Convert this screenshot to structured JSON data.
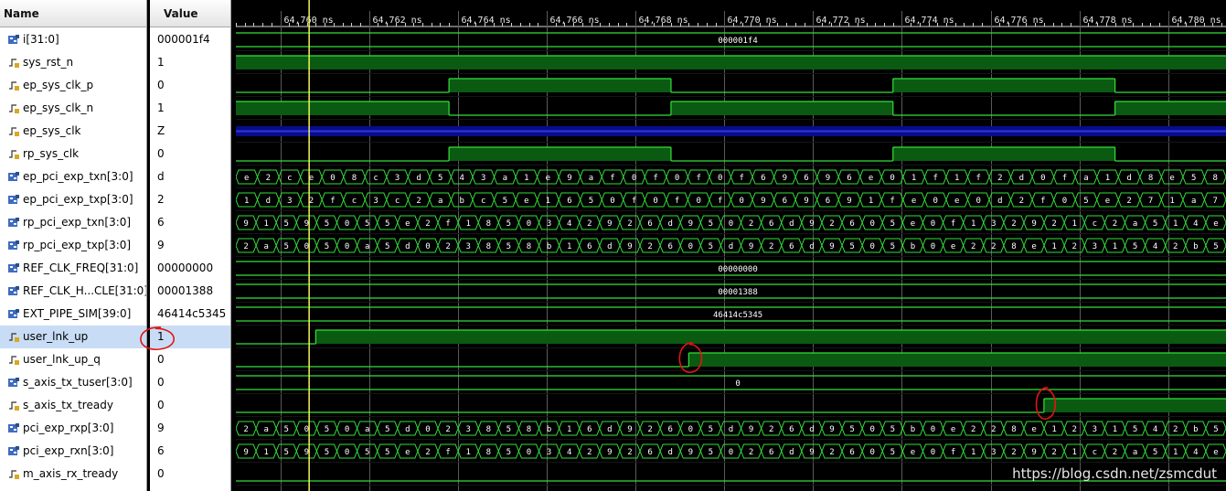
{
  "columns": {
    "name": "Name",
    "value": "Value"
  },
  "selected_row": 13,
  "signals": [
    {
      "name": "i[31:0]",
      "value": "000001f4",
      "icon": "bus-signal-icon",
      "kind": "const",
      "label": "000001f4"
    },
    {
      "name": "sys_rst_n",
      "value": "1",
      "icon": "logic-signal-icon",
      "kind": "high"
    },
    {
      "name": "ep_sys_clk_p",
      "value": "0",
      "icon": "logic-signal-icon",
      "kind": "clk_p"
    },
    {
      "name": "ep_sys_clk_n",
      "value": "1",
      "icon": "logic-signal-icon",
      "kind": "clk_n"
    },
    {
      "name": "ep_sys_clk",
      "value": "Z",
      "icon": "logic-signal-icon",
      "kind": "highz"
    },
    {
      "name": "rp_sys_clk",
      "value": "0",
      "icon": "logic-signal-icon",
      "kind": "clk_p"
    },
    {
      "name": "ep_pci_exp_txn[3:0]",
      "value": "d",
      "icon": "bus-signal-icon",
      "kind": "bus",
      "segments": [
        "e",
        "2",
        "c",
        "e",
        "0",
        "8",
        "c",
        "3",
        "d",
        "5",
        "4",
        "3",
        "a",
        "1",
        "e",
        "9",
        "a",
        "f",
        "0",
        "f",
        "0",
        "f",
        "0",
        "f",
        "6",
        "9",
        "6",
        "9",
        "6",
        "e",
        "0",
        "1",
        "f",
        "1",
        "f",
        "2",
        "d",
        "0",
        "f",
        "a",
        "1",
        "d",
        "8",
        "e",
        "5",
        "8"
      ]
    },
    {
      "name": "ep_pci_exp_txp[3:0]",
      "value": "2",
      "icon": "bus-signal-icon",
      "kind": "bus",
      "segments": [
        "1",
        "d",
        "3",
        "2",
        "f",
        "c",
        "3",
        "c",
        "2",
        "a",
        "b",
        "c",
        "5",
        "e",
        "1",
        "6",
        "5",
        "0",
        "f",
        "0",
        "f",
        "0",
        "f",
        "0",
        "9",
        "6",
        "9",
        "6",
        "9",
        "1",
        "f",
        "e",
        "0",
        "e",
        "0",
        "d",
        "2",
        "f",
        "0",
        "5",
        "e",
        "2",
        "7",
        "1",
        "a",
        "7"
      ]
    },
    {
      "name": "rp_pci_exp_txn[3:0]",
      "value": "6",
      "icon": "bus-signal-icon",
      "kind": "bus",
      "segments": [
        "9",
        "1",
        "5",
        "9",
        "5",
        "0",
        "5",
        "5",
        "e",
        "2",
        "f",
        "1",
        "8",
        "5",
        "0",
        "3",
        "4",
        "2",
        "9",
        "2",
        "6",
        "d",
        "9",
        "5",
        "0",
        "2",
        "6",
        "d",
        "9",
        "2",
        "6",
        "0",
        "5",
        "e",
        "0",
        "f",
        "1",
        "3",
        "2",
        "9",
        "2",
        "1",
        "c",
        "2",
        "a",
        "5",
        "1",
        "4",
        "e"
      ]
    },
    {
      "name": "rp_pci_exp_txp[3:0]",
      "value": "9",
      "icon": "bus-signal-icon",
      "kind": "bus",
      "segments": [
        "2",
        "a",
        "5",
        "0",
        "5",
        "0",
        "a",
        "5",
        "d",
        "0",
        "2",
        "3",
        "8",
        "5",
        "8",
        "b",
        "1",
        "6",
        "d",
        "9",
        "2",
        "6",
        "0",
        "5",
        "d",
        "9",
        "2",
        "6",
        "d",
        "9",
        "5",
        "0",
        "5",
        "b",
        "0",
        "e",
        "2",
        "2",
        "8",
        "e",
        "1",
        "2",
        "3",
        "1",
        "5",
        "4",
        "2",
        "b",
        "5"
      ]
    },
    {
      "name": "REF_CLK_FREQ[31:0]",
      "value": "00000000",
      "icon": "bus-signal-icon",
      "kind": "const",
      "label": "00000000"
    },
    {
      "name": "REF_CLK_H...CLE[31:0]",
      "value": "00001388",
      "icon": "bus-signal-icon",
      "kind": "const",
      "label": "00001388"
    },
    {
      "name": "EXT_PIPE_SIM[39:0]",
      "value": "46414c5345",
      "icon": "bus-signal-icon",
      "kind": "const",
      "label": "46414c5345"
    },
    {
      "name": "user_lnk_up",
      "value": "1",
      "icon": "logic-signal-icon",
      "kind": "step",
      "step_ns": 64760.8
    },
    {
      "name": "user_lnk_up_q",
      "value": "0",
      "icon": "logic-signal-icon",
      "kind": "step",
      "step_ns": 64769.2
    },
    {
      "name": "s_axis_tx_tuser[3:0]",
      "value": "0",
      "icon": "bus-signal-icon",
      "kind": "const",
      "label": "0"
    },
    {
      "name": "s_axis_tx_tready",
      "value": "0",
      "icon": "logic-signal-icon",
      "kind": "step",
      "step_ns": 64777.2
    },
    {
      "name": "pci_exp_rxp[3:0]",
      "value": "9",
      "icon": "bus-signal-icon",
      "kind": "bus",
      "segments": [
        "2",
        "a",
        "5",
        "0",
        "5",
        "0",
        "a",
        "5",
        "d",
        "0",
        "2",
        "3",
        "8",
        "5",
        "8",
        "b",
        "1",
        "6",
        "d",
        "9",
        "2",
        "6",
        "0",
        "5",
        "d",
        "9",
        "2",
        "6",
        "d",
        "9",
        "5",
        "0",
        "5",
        "b",
        "0",
        "e",
        "2",
        "2",
        "8",
        "e",
        "1",
        "2",
        "3",
        "1",
        "5",
        "4",
        "2",
        "b",
        "5"
      ]
    },
    {
      "name": "pci_exp_rxn[3:0]",
      "value": "6",
      "icon": "bus-signal-icon",
      "kind": "bus",
      "segments": [
        "9",
        "1",
        "5",
        "9",
        "5",
        "0",
        "5",
        "5",
        "e",
        "2",
        "f",
        "1",
        "8",
        "5",
        "0",
        "3",
        "4",
        "2",
        "9",
        "2",
        "6",
        "d",
        "9",
        "5",
        "0",
        "2",
        "6",
        "d",
        "9",
        "2",
        "6",
        "0",
        "5",
        "e",
        "0",
        "f",
        "1",
        "3",
        "2",
        "9",
        "2",
        "1",
        "c",
        "2",
        "a",
        "5",
        "1",
        "4",
        "e"
      ]
    },
    {
      "name": "m_axis_rx_tready",
      "value": "0",
      "icon": "logic-signal-icon",
      "kind": "low"
    }
  ],
  "timeline": {
    "start_ns": 64759.0,
    "end_ns": 64781.3,
    "ticks": [
      "64,760 ns",
      "64,762 ns",
      "64,764 ns",
      "64,766 ns",
      "64,768 ns",
      "64,770 ns",
      "64,772 ns",
      "64,774 ns",
      "64,776 ns",
      "64,778 ns",
      "64,780 ns"
    ],
    "tick_values_ns": [
      64760,
      64762,
      64764,
      64766,
      64768,
      64770,
      64772,
      64774,
      64776,
      64778,
      64780
    ],
    "cursor_ns": 64760.65
  },
  "clock": {
    "period_ns": 10,
    "first_rise_ns": 64763.8
  },
  "colors": {
    "wave_fill": "#0b5a12",
    "wave_line": "#32e03a",
    "highz_fill": "#0a0a8a",
    "highz_line": "#2b3ad8",
    "cursor": "#f4f45a",
    "grid": "#5a5a5a",
    "annotation": "#e01515"
  },
  "watermark": "https://blog.csdn.net/zsmcdut"
}
